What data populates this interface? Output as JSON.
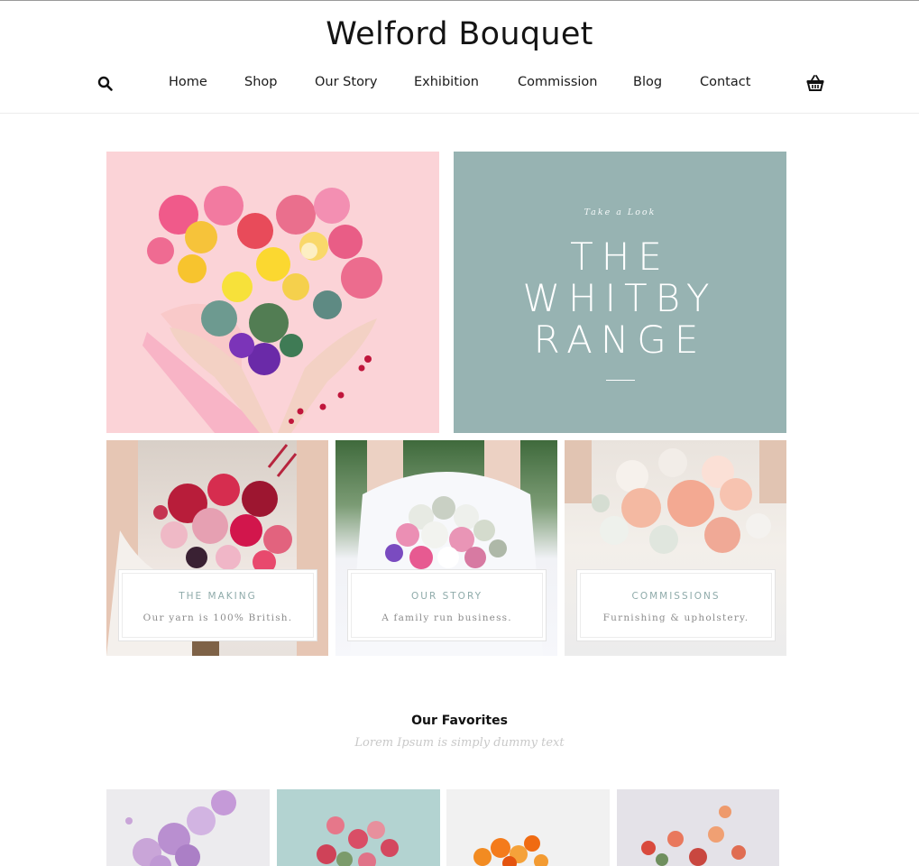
{
  "site": {
    "brand": "Welford Bouquet"
  },
  "nav": {
    "search_icon": "search-icon",
    "cart_icon": "basket-icon",
    "items": [
      {
        "label": "Home"
      },
      {
        "label": "Shop"
      },
      {
        "label": "Our Story"
      },
      {
        "label": "Exhibition"
      },
      {
        "label": "Commission"
      },
      {
        "label": "Blog"
      },
      {
        "label": "Contact"
      }
    ]
  },
  "hero": {
    "image": "heart-bouquet-image",
    "feature": {
      "kicker": "Take a Look",
      "line1": "THE",
      "line2": "WHITBY",
      "line3": "RANGE"
    }
  },
  "cards": [
    {
      "title": "THE MAKING",
      "subtitle": "Our yarn is 100% British."
    },
    {
      "title": "OUR STORY",
      "subtitle": "A family run business."
    },
    {
      "title": "COMMISSIONS",
      "subtitle": "Furnishing & upholstery."
    }
  ],
  "favorites": {
    "title": "Our Favorites",
    "subtitle": "Lorem Ipsum is simply dummy text"
  },
  "colors": {
    "hero_pink": "#fbd3d7",
    "hero_teal": "#97b3b2",
    "card_title": "#8fabaa"
  }
}
